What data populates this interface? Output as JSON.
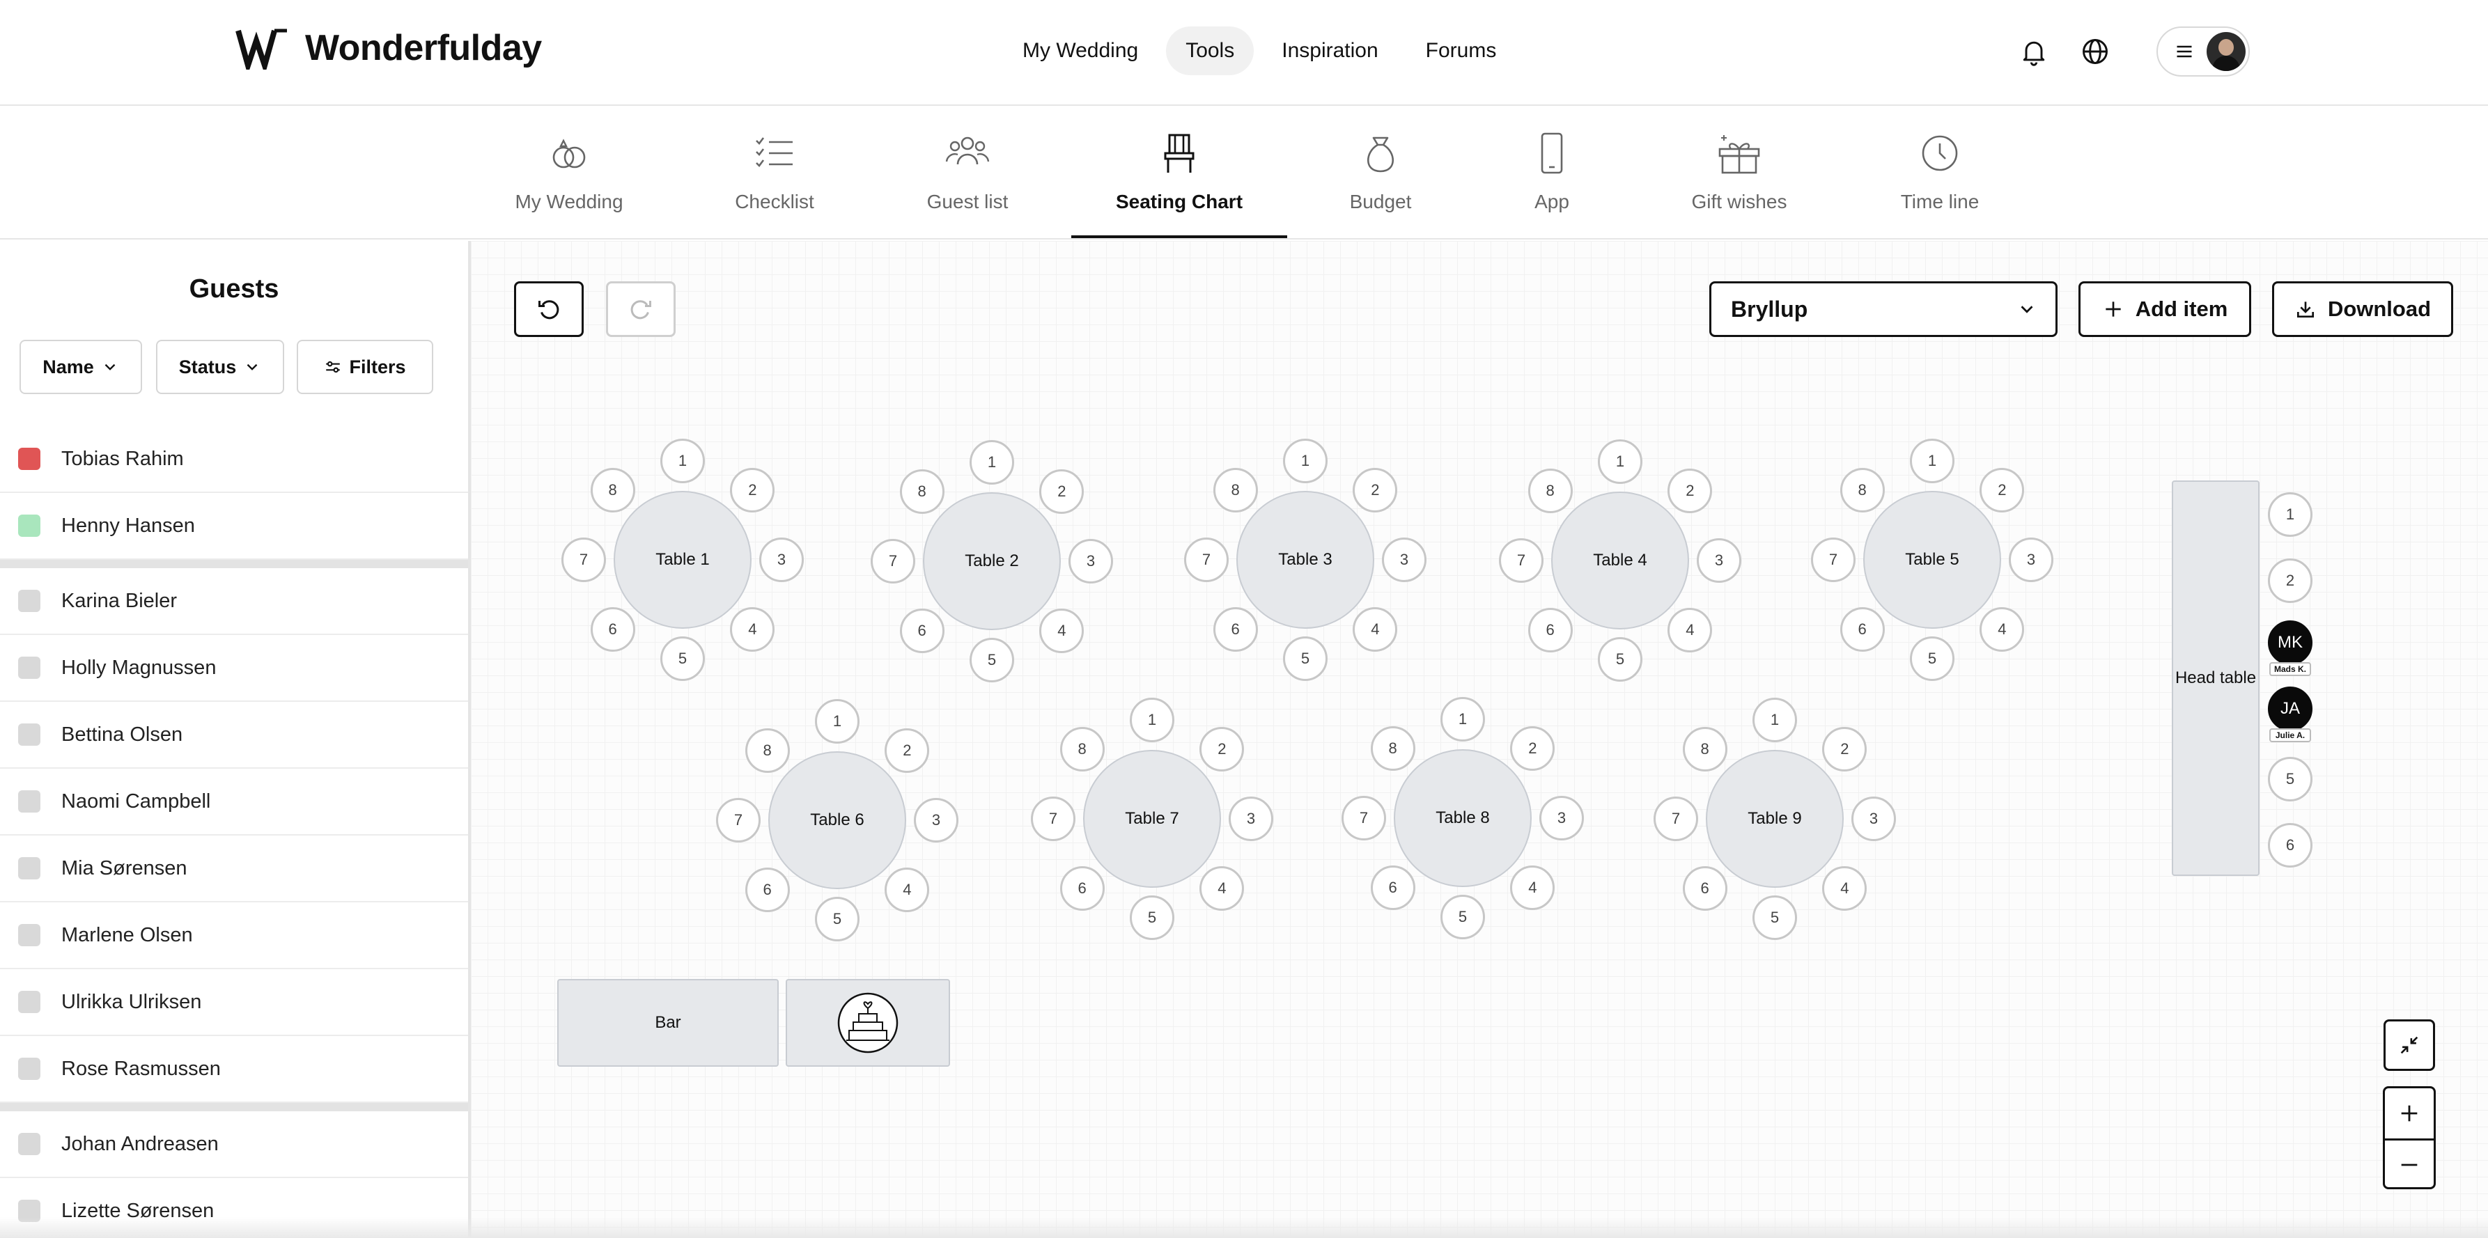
{
  "brand": {
    "name": "Wonderfulday"
  },
  "nav": {
    "items": [
      {
        "label": "My Wedding",
        "active": false
      },
      {
        "label": "Tools",
        "active": true
      },
      {
        "label": "Inspiration",
        "active": false
      },
      {
        "label": "Forums",
        "active": false
      }
    ]
  },
  "tools": {
    "items": [
      {
        "label": "My Wedding",
        "icon": "rings-icon",
        "active": false
      },
      {
        "label": "Checklist",
        "icon": "checklist-icon",
        "active": false
      },
      {
        "label": "Guest list",
        "icon": "guests-icon",
        "active": false
      },
      {
        "label": "Seating Chart",
        "icon": "chair-icon",
        "active": true
      },
      {
        "label": "Budget",
        "icon": "money-bag-icon",
        "active": false
      },
      {
        "label": "App",
        "icon": "phone-icon",
        "active": false
      },
      {
        "label": "Gift wishes",
        "icon": "gift-icon",
        "active": false
      },
      {
        "label": "Time line",
        "icon": "clock-icon",
        "active": false
      }
    ]
  },
  "sidebar": {
    "title": "Guests",
    "filters": {
      "name": "Name",
      "status": "Status",
      "filters": "Filters"
    },
    "guests": [
      {
        "name": "Tobias Rahim",
        "status_color": "#e05555"
      },
      {
        "name": "Henny Hansen",
        "status_color": "#a9e6bd"
      },
      {
        "separator": true
      },
      {
        "name": "Karina Bieler",
        "status_color": "#d9d9d9"
      },
      {
        "name": "Holly Magnussen",
        "status_color": "#d9d9d9"
      },
      {
        "name": "Bettina Olsen",
        "status_color": "#d9d9d9"
      },
      {
        "name": "Naomi Campbell",
        "status_color": "#d9d9d9"
      },
      {
        "name": "Mia Sørensen",
        "status_color": "#d9d9d9"
      },
      {
        "name": "Marlene Olsen",
        "status_color": "#d9d9d9"
      },
      {
        "name": "Ulrikka Ulriksen",
        "status_color": "#d9d9d9"
      },
      {
        "name": "Rose Rasmussen",
        "status_color": "#d9d9d9"
      },
      {
        "separator": true
      },
      {
        "name": "Johan Andreasen",
        "status_color": "#d9d9d9"
      },
      {
        "name": "Lizette Sørensen",
        "status_color": "#d9d9d9"
      }
    ]
  },
  "toolbar": {
    "event": "Bryllup",
    "add_item": "Add item",
    "download": "Download"
  },
  "tables": [
    {
      "label": "Table 1",
      "seats": [
        "1",
        "2",
        "3",
        "4",
        "5",
        "6",
        "7",
        "8"
      ]
    },
    {
      "label": "Table 2",
      "seats": [
        "1",
        "2",
        "3",
        "4",
        "5",
        "6",
        "7",
        "8"
      ]
    },
    {
      "label": "Table 3",
      "seats": [
        "1",
        "2",
        "3",
        "4",
        "5",
        "6",
        "7",
        "8"
      ]
    },
    {
      "label": "Table 4",
      "seats": [
        "1",
        "2",
        "3",
        "4",
        "5",
        "6",
        "7",
        "8"
      ]
    },
    {
      "label": "Table 5",
      "seats": [
        "1",
        "2",
        "3",
        "4",
        "5",
        "6",
        "7",
        "8"
      ]
    },
    {
      "label": "Table 6",
      "seats": [
        "1",
        "2",
        "3",
        "4",
        "5",
        "6",
        "7",
        "8"
      ]
    },
    {
      "label": "Table 7",
      "seats": [
        "1",
        "2",
        "3",
        "4",
        "5",
        "6",
        "7",
        "8"
      ]
    },
    {
      "label": "Table 8",
      "seats": [
        "1",
        "2",
        "3",
        "4",
        "5",
        "6",
        "7",
        "8"
      ]
    },
    {
      "label": "Table 9",
      "seats": [
        "1",
        "2",
        "3",
        "4",
        "5",
        "6",
        "7",
        "8"
      ]
    }
  ],
  "head_table": {
    "label": "Head table",
    "seats": [
      {
        "text": "1"
      },
      {
        "text": "2"
      },
      {
        "text": "MK",
        "name": "Mads K."
      },
      {
        "text": "JA",
        "name": "Julie A."
      },
      {
        "text": "5"
      },
      {
        "text": "6"
      }
    ]
  },
  "items": {
    "bar": "Bar",
    "cake": "cake-icon"
  }
}
